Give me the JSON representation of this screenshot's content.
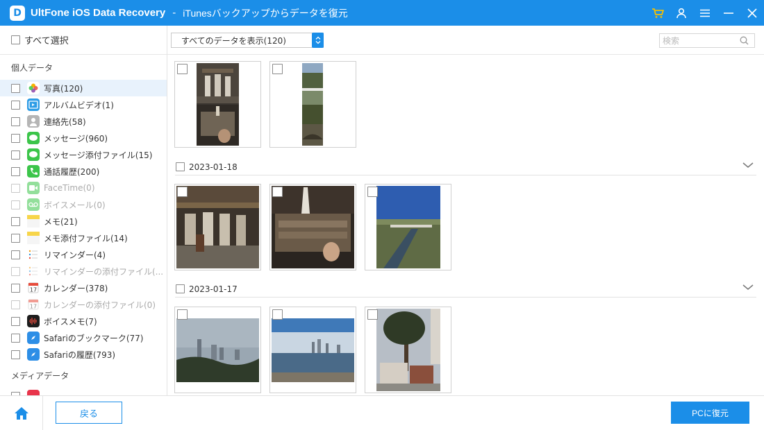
{
  "titlebar": {
    "logo_letter": "D",
    "app_name": "UltFone iOS Data Recovery",
    "separator": "-",
    "subtitle": "iTunesバックアップからデータを復元",
    "icons": [
      "cart-icon",
      "user-icon",
      "menu-icon",
      "minimize-icon",
      "close-icon"
    ],
    "accent": "#1b8ee8",
    "cart_color": "#f6c000"
  },
  "sidebar": {
    "select_all": "すべて選択",
    "section_personal": "個人データ",
    "section_media": "メディアデータ",
    "items": [
      {
        "label": "写真(120)",
        "icon": "photos-icon",
        "color": "#ffffff",
        "state": "active"
      },
      {
        "label": "アルバムビデオ(1)",
        "icon": "album-video-icon",
        "color": "#2d9ce6",
        "state": "normal"
      },
      {
        "label": "連絡先(58)",
        "icon": "contacts-icon",
        "color": "#b5b5b5",
        "state": "normal"
      },
      {
        "label": "メッセージ(960)",
        "icon": "messages-icon",
        "color": "#3cc54a",
        "state": "normal"
      },
      {
        "label": "メッセージ添付ファイル(15)",
        "icon": "message-attachment-icon",
        "color": "#3cc54a",
        "state": "normal"
      },
      {
        "label": "通話履歴(200)",
        "icon": "phone-icon",
        "color": "#3cc54a",
        "state": "normal"
      },
      {
        "label": "FaceTime(0)",
        "icon": "facetime-icon",
        "color": "#3cc54a",
        "state": "disabled"
      },
      {
        "label": "ボイスメール(0)",
        "icon": "voicemail-icon",
        "color": "#3cc54a",
        "state": "disabled"
      },
      {
        "label": "メモ(21)",
        "icon": "notes-icon",
        "color": "#f7d54a",
        "state": "normal"
      },
      {
        "label": "メモ添付ファイル(14)",
        "icon": "notes-attachment-icon",
        "color": "#f7d54a",
        "state": "normal"
      },
      {
        "label": "リマインダー(4)",
        "icon": "reminders-icon",
        "color": "#ffffff",
        "state": "normal"
      },
      {
        "label": "リマインダーの添付ファイル(...",
        "icon": "reminders-attachment-icon",
        "color": "#ffffff",
        "state": "disabled"
      },
      {
        "label": "カレンダー(378)",
        "icon": "calendar-icon",
        "color": "#ffffff",
        "state": "normal"
      },
      {
        "label": "カレンダーの添付ファイル(0)",
        "icon": "calendar-attachment-icon",
        "color": "#ffffff",
        "state": "disabled"
      },
      {
        "label": "ボイスメモ(7)",
        "icon": "voice-memo-icon",
        "color": "#1d1d1d",
        "state": "normal"
      },
      {
        "label": "Safariのブックマーク(77)",
        "icon": "safari-bookmark-icon",
        "color": "#2d8ee6",
        "state": "normal"
      },
      {
        "label": "Safariの履歴(793)",
        "icon": "safari-history-icon",
        "color": "#2d8ee6",
        "state": "normal"
      }
    ]
  },
  "toolbar": {
    "filter_value": "すべてのデータを表示(120)",
    "search_placeholder": "検索"
  },
  "groups": [
    {
      "date": "",
      "photos": [
        "temple-statues-vertical-photo",
        "mountain-village-vertical-photo"
      ]
    },
    {
      "date": "2023-01-18",
      "photos": [
        "temple-courtyard-statues-photo",
        "temple-altar-statues-photo",
        "canal-hillside-photo"
      ]
    },
    {
      "date": "2023-01-17",
      "photos": [
        "city-skyline-hill-photo",
        "harbor-skyline-photo",
        "tree-houses-photo"
      ]
    }
  ],
  "footer": {
    "back_label": "戻る",
    "recover_label": "PCに復元"
  }
}
